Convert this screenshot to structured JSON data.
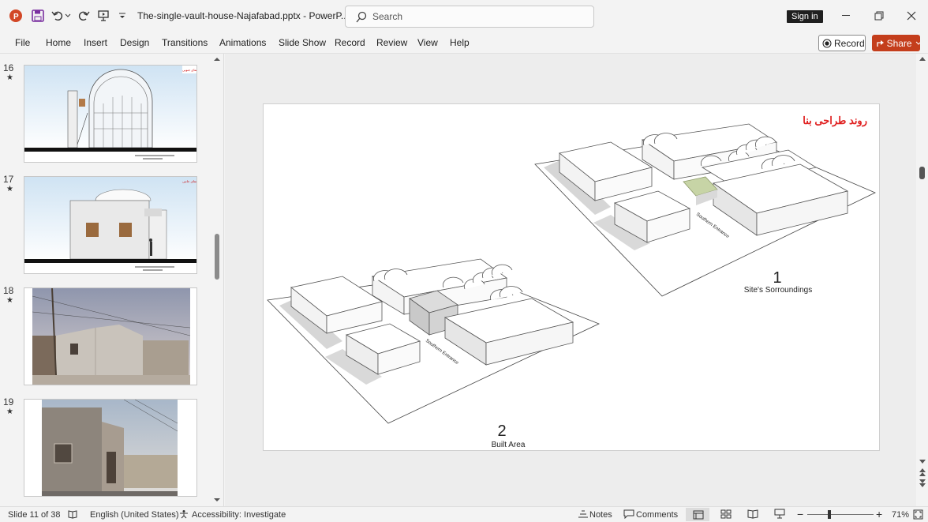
{
  "titlebar": {
    "doc_title": "The-single-vault-house-Najafabad.pptx  -  PowerP...",
    "search_placeholder": "Search",
    "sign_in": "Sign in"
  },
  "ribbon": {
    "tabs": [
      "File",
      "Home",
      "Insert",
      "Design",
      "Transitions",
      "Animations",
      "Slide Show",
      "Record",
      "Review",
      "View",
      "Help"
    ],
    "record_label": "Record",
    "share_label": "Share"
  },
  "thumbnails": [
    {
      "num": "16",
      "star": "★"
    },
    {
      "num": "17",
      "star": "★"
    },
    {
      "num": "18",
      "star": "★"
    },
    {
      "num": "19",
      "star": "★"
    }
  ],
  "slide": {
    "title_fa": "روند طراحی بنا",
    "figure1_num": "1",
    "figure1_caption": "Site's Sorroundings",
    "figure2_num": "2",
    "figure2_caption": "Built Area",
    "label_entrance_1": "Southern Entrance",
    "label_entrance_2": "Southern Entrance"
  },
  "status": {
    "slide_info": "Slide 11 of 38",
    "language": "English (United States)",
    "accessibility": "Accessibility: Investigate",
    "notes": "Notes",
    "comments": "Comments",
    "zoom": "71%"
  },
  "colors": {
    "accent_share": "#c43e1c",
    "title_red": "#e02020",
    "signin_bg": "#1f1f1f"
  }
}
